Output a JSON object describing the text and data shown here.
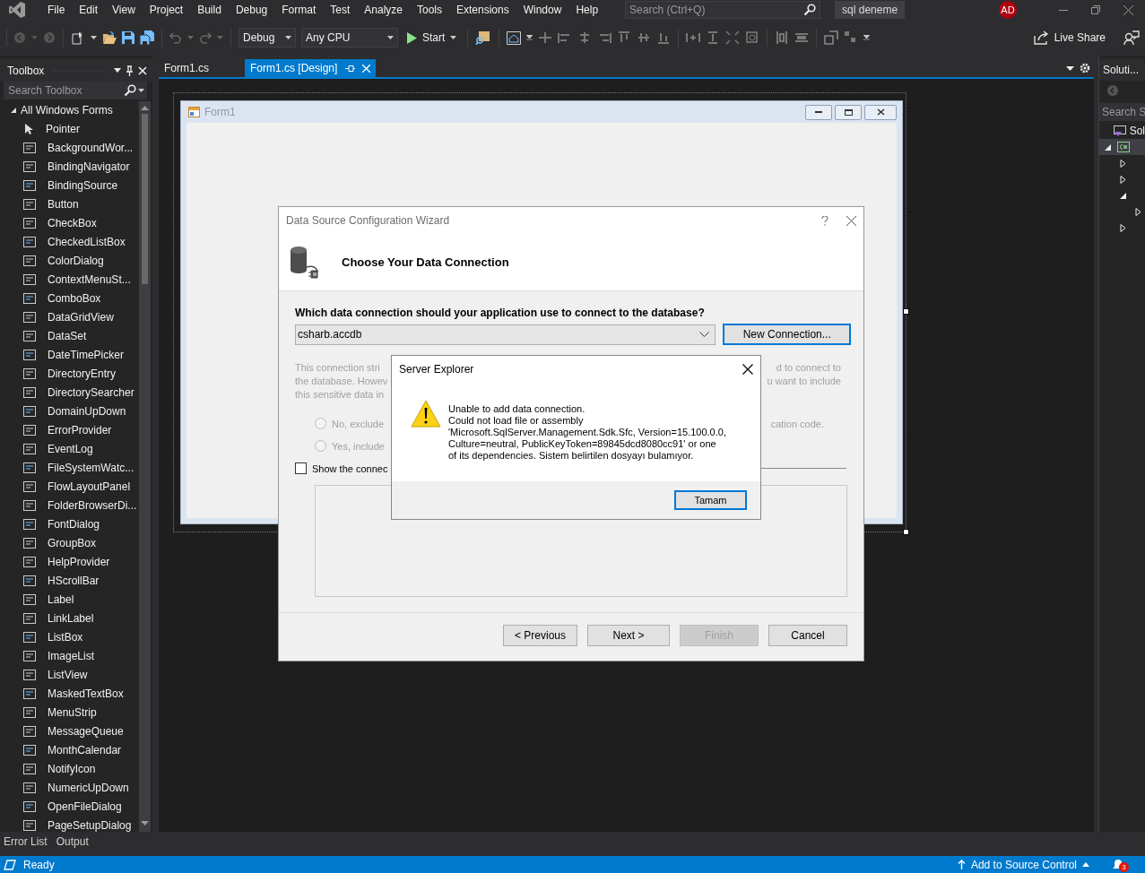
{
  "menu": [
    "File",
    "Edit",
    "View",
    "Project",
    "Build",
    "Debug",
    "Format",
    "Test",
    "Analyze",
    "Tools",
    "Extensions",
    "Window",
    "Help"
  ],
  "search": {
    "placeholder": "Search (Ctrl+Q)"
  },
  "solution_name": "sql deneme",
  "user_initials": "AD",
  "toolbar": {
    "configuration": "Debug",
    "platform": "Any CPU",
    "start": "Start",
    "live_share": "Live Share"
  },
  "toolbox": {
    "title": "Toolbox",
    "search": {
      "placeholder": "Search Toolbox"
    },
    "group": {
      "label": "All Windows Forms",
      "expanded": true,
      "items": [
        "Pointer",
        "BackgroundWor...",
        "BindingNavigator",
        "BindingSource",
        "Button",
        "CheckBox",
        "CheckedListBox",
        "ColorDialog",
        "ContextMenuSt...",
        "ComboBox",
        "DataGridView",
        "DataSet",
        "DateTimePicker",
        "DirectoryEntry",
        "DirectorySearcher",
        "DomainUpDown",
        "ErrorProvider",
        "EventLog",
        "FileSystemWatc...",
        "FlowLayoutPanel",
        "FolderBrowserDi...",
        "FontDialog",
        "GroupBox",
        "HelpProvider",
        "HScrollBar",
        "Label",
        "LinkLabel",
        "ListBox",
        "ImageList",
        "ListView",
        "MaskedTextBox",
        "MenuStrip",
        "MessageQueue",
        "MonthCalendar",
        "NotifyIcon",
        "NumericUpDown",
        "OpenFileDialog",
        "PageSetupDialog"
      ]
    }
  },
  "tabs": [
    {
      "label": "Form1.cs",
      "selected": false
    },
    {
      "label": "Form1.cs [Design]",
      "selected": true
    }
  ],
  "form": {
    "title": "Form1"
  },
  "wizard": {
    "title": "Data Source Configuration Wizard",
    "heading": "Choose Your Data Connection",
    "question": "Which data connection should your application use to connect to the database?",
    "connection": "csharb.accdb",
    "new_connection": "New Connection...",
    "sensitive_info": {
      "disabled": true,
      "lines": [
        {
          "left": "This connection stri",
          "right": "d to connect to"
        },
        {
          "left": "the database. Howev",
          "right": "u want to include"
        },
        {
          "left": "this sensitive data in"
        }
      ]
    },
    "options": [
      {
        "label_start": "No, exclude",
        "label_end": "cation code.",
        "selected": false
      },
      {
        "label_start": "Yes, include",
        "selected": false
      }
    ],
    "show_connection_string": {
      "label": "Show the connec",
      "checked": false
    },
    "buttons": [
      {
        "label": "< Previous",
        "disabled": false
      },
      {
        "label": "Next >",
        "disabled": false
      },
      {
        "label": "Finish",
        "disabled": true
      },
      {
        "label": "Cancel",
        "disabled": false
      }
    ]
  },
  "message_box": {
    "title": "Server Explorer",
    "message": "Unable to add data connection.\nCould not load file or assembly\n'Microsoft.SqlServer.Management.Sdk.Sfc, Version=15.100.0.0,\nCulture=neutral, PublicKeyToken=89845dcd8080cc91' or one\nof its dependencies. Sistem belirtilen dosyayı bulamıyor.",
    "button": "Tamam"
  },
  "solution_explorer": {
    "title": "Soluti...",
    "search": {
      "placeholder": "Search S"
    },
    "tree": [
      {
        "kind": "solution",
        "label": "Sol",
        "selected": false
      },
      {
        "kind": "project",
        "expanded": true,
        "selected": true,
        "children": [
          {
            "expanded": false,
            "selected": false
          },
          {
            "expanded": false,
            "selected": false
          },
          {
            "expanded": true,
            "selected": false,
            "children": [
              {
                "expanded": false,
                "selected": false
              }
            ]
          },
          {
            "expanded": false,
            "selected": false
          }
        ]
      }
    ]
  },
  "bottom_tabs": [
    "Error List",
    "Output"
  ],
  "status_bar": {
    "text": "Ready",
    "source_control": "Add to Source Control",
    "notifications": "3"
  }
}
